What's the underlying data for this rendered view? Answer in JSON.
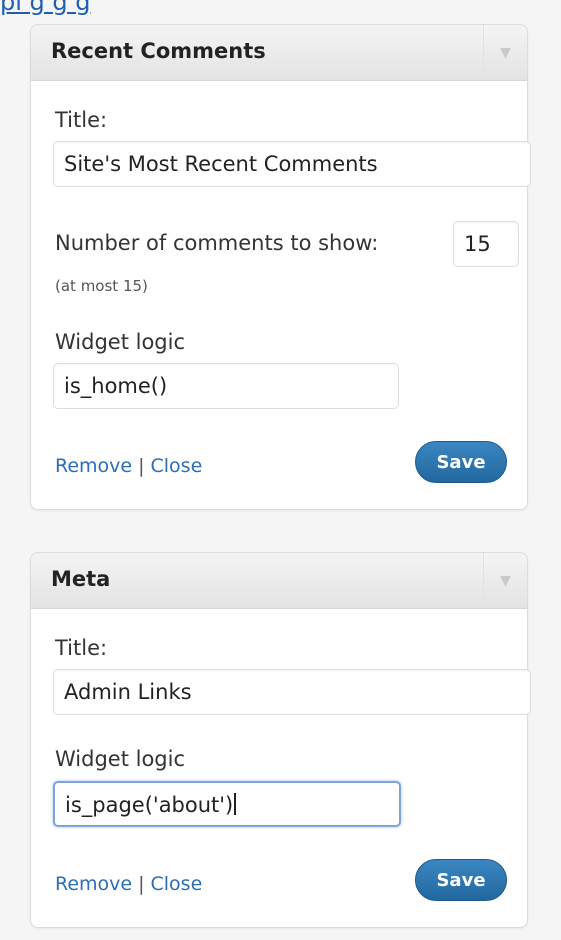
{
  "top_link": {
    "text": "pl g   g g"
  },
  "widgets": [
    {
      "title": "Recent Comments",
      "title_label": "Title:",
      "title_value": "Site's Most Recent Comments",
      "count_label": "Number of comments to show:",
      "count_value": "15",
      "count_note": "(at most 15)",
      "logic_label": "Widget logic",
      "logic_value": "is_home()",
      "remove_label": "Remove",
      "separator": "|",
      "close_label": "Close",
      "save_label": "Save"
    },
    {
      "title": "Meta",
      "title_label": "Title:",
      "title_value": "Admin Links",
      "logic_label": "Widget logic",
      "logic_value": "is_page('about')",
      "remove_label": "Remove",
      "separator": "|",
      "close_label": "Close",
      "save_label": "Save"
    }
  ],
  "icons": {
    "collapse_toggle": "triangle-down-icon"
  },
  "colors": {
    "link": "#2d6db5",
    "save_button": "#2a76b0",
    "focus_border": "#7fa4d6"
  }
}
